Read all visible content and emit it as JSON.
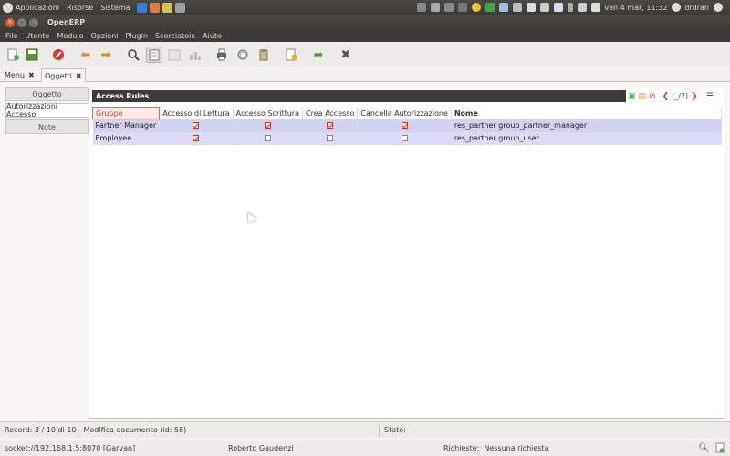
{
  "top_panel": {
    "menus": [
      "Applicazioni",
      "Risorse",
      "Sistema"
    ],
    "datetime": "ven  4 mar, 11:32",
    "user": "drdran"
  },
  "window": {
    "title": "OpenERP"
  },
  "menubar": [
    "File",
    "Utente",
    "Modulo",
    "Opzioni",
    "Plugin",
    "Scorciatoie",
    "Aiuto"
  ],
  "toolbar_icons": [
    "new-icon",
    "save-icon",
    "delete-icon",
    "previous-icon",
    "next-icon",
    "search-icon",
    "form-view-icon",
    "list-view-icon",
    "graph-icon",
    "print-icon",
    "actions-icon",
    "attachment-icon",
    "report-icon",
    "go-icon",
    "close-icon"
  ],
  "tabs": [
    {
      "label": "Menu"
    },
    {
      "label": "Oggetti"
    }
  ],
  "side_tabs": [
    "Oggetto",
    "Autorizzazioni Accesso",
    "Note"
  ],
  "access_rules": {
    "title": "Access Rules",
    "pager": "(_/2)",
    "columns": [
      "Gruppo",
      "Accesso di Lettura",
      "Accesso Scrittura",
      "Crea Accesso",
      "Cancella Autorizzazione",
      "Nome"
    ],
    "rows": [
      {
        "group": "Partner Manager",
        "read": true,
        "write": true,
        "create": true,
        "unlink": true,
        "name": "res_partner group_partner_manager"
      },
      {
        "group": "Employee",
        "read": true,
        "write": false,
        "create": false,
        "unlink": false,
        "name": "res_partner group_user"
      }
    ]
  },
  "status": {
    "record": "Record: 3 / 10 di 10 - Modifica documento (id: 58)",
    "state_label": "Stato:",
    "socket": "socket://192.168.1.5:8070 [Garvan]",
    "user_name": "Roberto Gaudenzi",
    "requests_label": "Richieste:",
    "requests_value": "Nessuna richiesta"
  }
}
